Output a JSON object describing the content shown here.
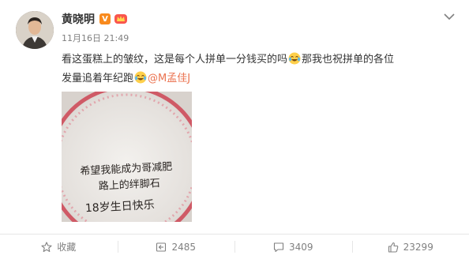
{
  "user": {
    "name": "黄晓明",
    "vip_badge": "V"
  },
  "post": {
    "timestamp": "11月16日 21:49",
    "text_part1": "看这蛋糕上的皱纹，这是每个人拼单一分钱买的吗",
    "text_part2": "那我也祝拼单的各位发量追着年纪跑",
    "mention": "@M孟佳J"
  },
  "cake": {
    "line1": "希望我能成为哥减肥",
    "line2": "路上的绊脚石",
    "line3": "18岁生日快乐"
  },
  "actions": {
    "favorite_label": "收藏",
    "repost_count": "2485",
    "comment_count": "3409",
    "like_count": "23299"
  },
  "icons": {
    "more": "chevron-down-icon",
    "favorite": "star-icon",
    "repost": "repost-icon",
    "comment": "comment-icon",
    "like": "thumbs-up-icon"
  },
  "colors": {
    "mention": "#eb7350",
    "vip": "#f88a1d"
  }
}
